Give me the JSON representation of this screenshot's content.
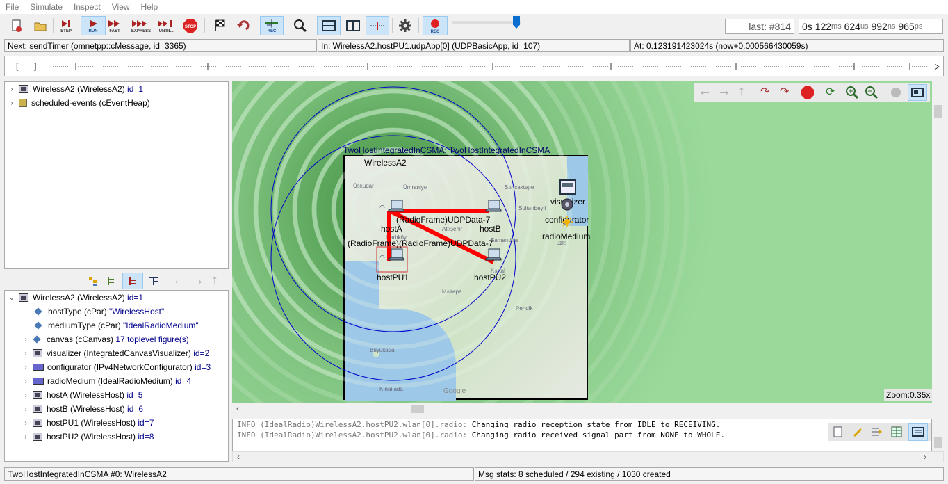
{
  "menu": [
    "File",
    "Simulate",
    "Inspect",
    "View",
    "Help"
  ],
  "toolbar": {
    "step": "STEP",
    "run": "RUN",
    "fast": "FAST",
    "express": "EXPRESS",
    "until": "UNTIL...",
    "stop": "STOP",
    "rec": "REC",
    "rec2": "REC"
  },
  "counters": {
    "last_label": "last: #814",
    "time": {
      "s": "0s",
      "ms_val": "122",
      "ms": "ms",
      "us_val": "624",
      "us": "us",
      "ns_val": "992",
      "ns": "ns",
      "ps_val": "965",
      "ps": "ps"
    }
  },
  "status": {
    "next": "Next: sendTimer (omnetpp::cMessage, id=3365)",
    "in": "In: WirelessA2.hostPU1.udpApp[0] (UDPBasicApp, id=107)",
    "at": "At: 0.123191423024s (now+0.000566430059s)"
  },
  "timeline": {
    "left_bracket": "[",
    "right_bracket": "]"
  },
  "object_tree": [
    {
      "name": "WirelessA2 (WirelessA2)",
      "id": "id=1",
      "icon": "module-icon"
    },
    {
      "name": "scheduled-events (cEventHeap)",
      "id": "",
      "icon": "heap-icon"
    }
  ],
  "inspector": {
    "root": {
      "name": "WirelessA2 (WirelessA2)",
      "id": "id=1"
    },
    "params": [
      {
        "name": "hostType (cPar)",
        "value": "\"WirelessHost\""
      },
      {
        "name": "mediumType (cPar)",
        "value": "\"IdealRadioMedium\""
      }
    ],
    "children": [
      {
        "name": "canvas (cCanvas)",
        "id": "17 toplevel figure(s)",
        "icon": "dia"
      },
      {
        "name": "visualizer (IntegratedCanvasVisualizer)",
        "id": "id=2",
        "icon": "box"
      },
      {
        "name": "configurator (IPv4NetworkConfigurator)",
        "id": "id=3",
        "icon": "flat"
      },
      {
        "name": "radioMedium (IdealRadioMedium)",
        "id": "id=4",
        "icon": "flat"
      },
      {
        "name": "hostA (WirelessHost)",
        "id": "id=5",
        "icon": "box"
      },
      {
        "name": "hostB (WirelessHost)",
        "id": "id=6",
        "icon": "box"
      },
      {
        "name": "hostPU1 (WirelessHost)",
        "id": "id=7",
        "icon": "box"
      },
      {
        "name": "hostPU2 (WirelessHost)",
        "id": "id=8",
        "icon": "box"
      }
    ]
  },
  "network": {
    "title": "TwoHostIntegratedInCSMA: TwoHostIntegratedInCSMA",
    "module_name": "WirelessA2",
    "nodes": {
      "hostA": "hostA",
      "hostB": "hostB",
      "hostPU1": "hostPU1",
      "hostPU2": "hostPU2",
      "visualizer": "visualizer",
      "configurator": "configurator",
      "radioMedium": "radioMedium"
    },
    "packets": {
      "p1": "(RadioFrame)UDPData-7",
      "p2": "(RadioFrame)(RadioFrame)UDPData-7"
    },
    "map_labels": [
      "Üsküdar",
      "Ümraniye",
      "Kadıköy",
      "Ataşehir",
      "Maltepe",
      "Pendik",
      "Kartal",
      "Sultanbeyli",
      "Samandıra",
      "Tuzla",
      "Büyükada",
      "Sancaktepe",
      "Kınalıada"
    ],
    "zoom": "Zoom:0.35x",
    "google": "Google",
    "colors": {
      "link": "#ff0000",
      "range_circle": "#0000cc",
      "bg": "#9ad99a"
    }
  },
  "log": [
    {
      "prefix": "INFO (IdealRadio)WirelessA2.hostPU2.wlan[0].radio:",
      "text": " Changing radio reception state from IDLE to RECEIVING."
    },
    {
      "prefix": "INFO (IdealRadio)WirelessA2.hostPU2.wlan[0].radio:",
      "text": " Changing radio received signal part from NONE to WHOLE."
    }
  ],
  "bottom": {
    "left": "TwoHostIntegratedInCSMA #0: WirelessA2",
    "right": "Msg stats: 8 scheduled / 294 existing / 1030 created"
  }
}
